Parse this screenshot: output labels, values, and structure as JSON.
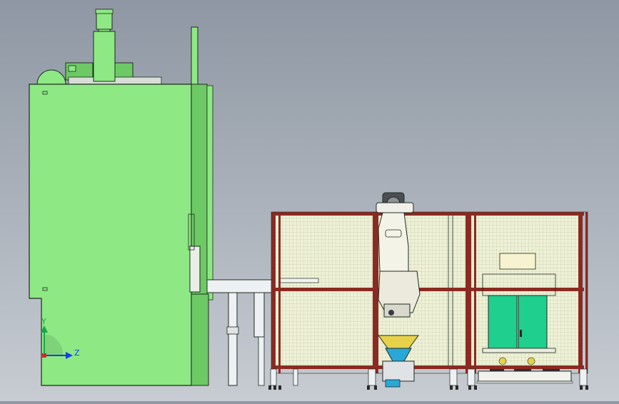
{
  "colors": {
    "background_top": "#8e97a3",
    "background_bottom": "#c7ccd2",
    "machine_green": "#8ee884",
    "machine_green_dark": "#6cc964",
    "outline": "#1f2a1f",
    "frame_red": "#8b2a22",
    "mesh_fill": "#eef1d6",
    "hopper_yellow": "#e6d24a",
    "hopper_blue": "#29a8d8",
    "cabinet_teal": "#1fcf8e",
    "pipe_gray": "#e8ecee",
    "triad_green": "#1aa64a",
    "triad_blue": "#1a3ee6",
    "triad_red": "#d22b2b"
  },
  "triad": {
    "y_label": "Y",
    "z_label": "Z"
  }
}
